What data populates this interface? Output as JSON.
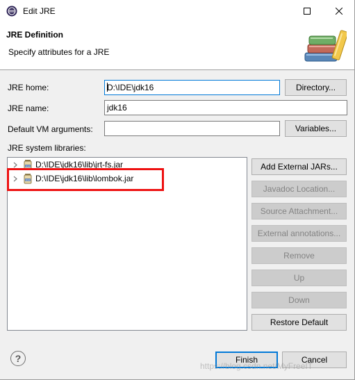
{
  "window": {
    "title": "Edit JRE"
  },
  "header": {
    "title": "JRE Definition",
    "subtitle": "Specify attributes for a JRE"
  },
  "form": {
    "jre_home_label": "JRE home:",
    "jre_home_value": "D:\\IDE\\jdk16",
    "directory_button": "Directory...",
    "jre_name_label": "JRE name:",
    "jre_name_value": "jdk16",
    "vm_args_label": "Default VM arguments:",
    "vm_args_value": "",
    "variables_button": "Variables...",
    "libraries_label": "JRE system libraries:"
  },
  "libraries": [
    {
      "path": "D:\\IDE\\jdk16\\lib\\jrt-fs.jar"
    },
    {
      "path": "D:\\IDE\\jdk16\\lib\\lombok.jar"
    }
  ],
  "library_buttons": {
    "add_external_jars": "Add External JARs...",
    "javadoc_location": "Javadoc Location...",
    "source_attachment": "Source Attachment...",
    "external_annotations": "External annotations...",
    "remove": "Remove",
    "up": "Up",
    "down": "Down",
    "restore_default": "Restore Default"
  },
  "footer": {
    "help": "?",
    "finish": "Finish",
    "cancel": "Cancel",
    "watermark": "https://blog.csdn.net/MyFreeIT"
  },
  "colors": {
    "highlight_border": "#ee1111",
    "default_button_border": "#0078d7",
    "panel_background": "#f0f0f0"
  }
}
